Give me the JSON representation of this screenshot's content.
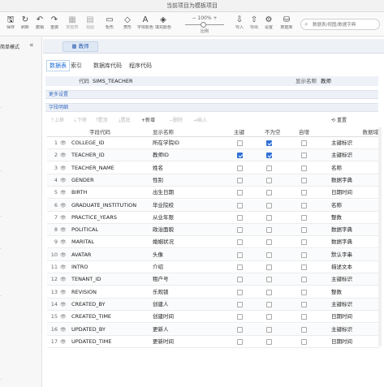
{
  "window": {
    "title": "当前项目为模板项目"
  },
  "toolbar": {
    "items": [
      {
        "icon": "save-icon",
        "glyph": "🖫",
        "label": "保存",
        "enabled": true
      },
      {
        "icon": "refresh-icon",
        "glyph": "↻",
        "label": "刷新",
        "enabled": true
      },
      {
        "icon": "undo-icon",
        "glyph": "↶",
        "label": "撤销",
        "enabled": true
      },
      {
        "icon": "redo-icon",
        "glyph": "↷",
        "label": "重做",
        "enabled": true
      },
      {
        "icon": "new-table-icon",
        "glyph": "▦",
        "label": "数据表",
        "enabled": false
      },
      {
        "icon": "add-view-icon",
        "glyph": "▤",
        "label": "视图",
        "enabled": false
      },
      {
        "icon": "rectangle-icon",
        "glyph": "▭",
        "label": "矩形",
        "enabled": true
      },
      {
        "icon": "diamond-icon",
        "glyph": "◇",
        "label": "菱形",
        "enabled": true
      },
      {
        "icon": "font-color-icon",
        "glyph": "A",
        "label": "字体颜色",
        "enabled": true
      },
      {
        "icon": "fill-color-icon",
        "glyph": "◈",
        "label": "填充颜色",
        "enabled": true
      },
      {
        "icon": "import-icon",
        "glyph": "⇩",
        "label": "导入",
        "enabled": true
      },
      {
        "icon": "export-icon",
        "glyph": "⇧",
        "label": "导出",
        "enabled": true
      },
      {
        "icon": "settings-icon",
        "glyph": "⚙",
        "label": "设置",
        "enabled": true
      },
      {
        "icon": "database-icon",
        "glyph": "⛁",
        "label": "数据库",
        "enabled": true
      }
    ],
    "zoom": {
      "minus": "−",
      "value": "100%",
      "plus": "+",
      "label": "比例"
    }
  },
  "search": {
    "placeholder": "数据表/视图/数据字典"
  },
  "sidebar": {
    "mode_label": "简单模式",
    "collapse_glyph": "«"
  },
  "doc_tab": {
    "icon": "table-icon",
    "label": "教师"
  },
  "sub_tabs": [
    {
      "label": "数据表",
      "active": true
    },
    {
      "label": "索引",
      "active": false
    },
    {
      "label": "数据库代码",
      "active": false
    },
    {
      "label": "程序代码",
      "active": false
    }
  ],
  "props": {
    "code_label": "代码",
    "code_value": "SIMS_TEACHER",
    "display_label": "显示名称",
    "display_value": "教师"
  },
  "sections": {
    "more_settings": "更多设置",
    "field_header": "字段明细"
  },
  "grid_toolbar": {
    "buttons": [
      {
        "label": "⇡上移",
        "enabled": false
      },
      {
        "label": "⇣下移",
        "enabled": false
      },
      {
        "label": "⤒置顶",
        "enabled": false
      },
      {
        "label": "⤓置底",
        "enabled": false
      },
      {
        "label": "+新增",
        "enabled": true
      },
      {
        "label": "−删除",
        "enabled": false
      },
      {
        "label": "⇥插入",
        "enabled": false
      }
    ],
    "reset": "重置"
  },
  "grid": {
    "columns": [
      "",
      "字段代码",
      "显示名称",
      "主键",
      "不为空",
      "自增",
      "数据域"
    ],
    "rows": [
      {
        "n": "1",
        "code": "COLLEGE_ID",
        "name": "所在学院ID",
        "pk": false,
        "notnull": true,
        "autoinc": false,
        "domain": "主键标识"
      },
      {
        "n": "2",
        "code": "TEACHER_ID",
        "name": "教师ID",
        "pk": true,
        "notnull": true,
        "autoinc": false,
        "domain": "主键标识"
      },
      {
        "n": "3",
        "code": "TEACHER_NAME",
        "name": "姓名",
        "pk": false,
        "notnull": false,
        "autoinc": false,
        "domain": "名称"
      },
      {
        "n": "4",
        "code": "GENDER",
        "name": "性别",
        "pk": false,
        "notnull": false,
        "autoinc": false,
        "domain": "数据字典"
      },
      {
        "n": "5",
        "code": "BIRTH",
        "name": "出生日期",
        "pk": false,
        "notnull": false,
        "autoinc": false,
        "domain": "日期时间"
      },
      {
        "n": "6",
        "code": "GRADUATE_INSTITUTION",
        "name": "毕业院校",
        "pk": false,
        "notnull": false,
        "autoinc": false,
        "domain": "名称"
      },
      {
        "n": "7",
        "code": "PRACTICE_YEARS",
        "name": "从业年限",
        "pk": false,
        "notnull": false,
        "autoinc": false,
        "domain": "整数"
      },
      {
        "n": "8",
        "code": "POLITICAL",
        "name": "政治面貌",
        "pk": false,
        "notnull": false,
        "autoinc": false,
        "domain": "数据字典"
      },
      {
        "n": "9",
        "code": "MARITAL",
        "name": "婚姻状况",
        "pk": false,
        "notnull": false,
        "autoinc": false,
        "domain": "数据字典"
      },
      {
        "n": "10",
        "code": "AVATAR",
        "name": "头像",
        "pk": false,
        "notnull": false,
        "autoinc": false,
        "domain": "默认字串"
      },
      {
        "n": "11",
        "code": "INTRO",
        "name": "介绍",
        "pk": false,
        "notnull": false,
        "autoinc": false,
        "domain": "描述文本"
      },
      {
        "n": "12",
        "code": "TENANT_ID",
        "name": "租户号",
        "pk": false,
        "notnull": false,
        "autoinc": false,
        "domain": "主键标识"
      },
      {
        "n": "13",
        "code": "REVISION",
        "name": "乐观锁",
        "pk": false,
        "notnull": false,
        "autoinc": false,
        "domain": "整数"
      },
      {
        "n": "14",
        "code": "CREATED_BY",
        "name": "创建人",
        "pk": false,
        "notnull": false,
        "autoinc": false,
        "domain": "主键标识"
      },
      {
        "n": "15",
        "code": "CREATED_TIME",
        "name": "创建时间",
        "pk": false,
        "notnull": false,
        "autoinc": false,
        "domain": "日期时间"
      },
      {
        "n": "16",
        "code": "UPDATED_BY",
        "name": "更新人",
        "pk": false,
        "notnull": false,
        "autoinc": false,
        "domain": "主键标识"
      },
      {
        "n": "17",
        "code": "UPDATED_TIME",
        "name": "更新时间",
        "pk": false,
        "notnull": false,
        "autoinc": false,
        "domain": "日期时间"
      }
    ]
  }
}
